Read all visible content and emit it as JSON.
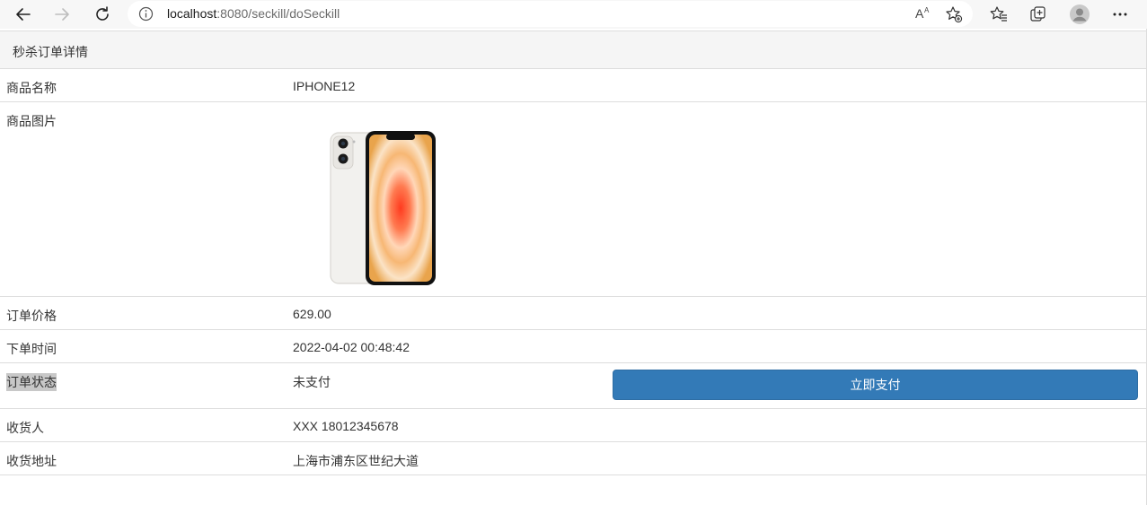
{
  "browser": {
    "url_host": "localhost",
    "url_path": ":8080/seckill/doSeckill",
    "icons": [
      "back-icon",
      "forward-icon",
      "refresh-icon",
      "info-icon",
      "read-aloud-icon",
      "add-favorite-icon",
      "favorites-icon",
      "collections-icon",
      "profile-icon",
      "more-icon"
    ]
  },
  "panel": {
    "heading": "秒杀订单详情"
  },
  "rows": {
    "name": {
      "label": "商品名称",
      "value": "IPHONE12"
    },
    "image": {
      "label": "商品图片"
    },
    "price": {
      "label": "订单价格",
      "value": "629.00"
    },
    "time": {
      "label": "下单时间",
      "value": "2022-04-02 00:48:42"
    },
    "status": {
      "label": "订单状态",
      "value": "未支付",
      "button": "立即支付"
    },
    "receiver": {
      "label": "收货人",
      "value": "XXX 18012345678"
    },
    "address": {
      "label": "收货地址",
      "value": "上海市浦东区世纪大道"
    }
  },
  "colors": {
    "primary_button": "#337ab7",
    "heading_bg": "#f5f5f5",
    "border": "#dddddd"
  }
}
